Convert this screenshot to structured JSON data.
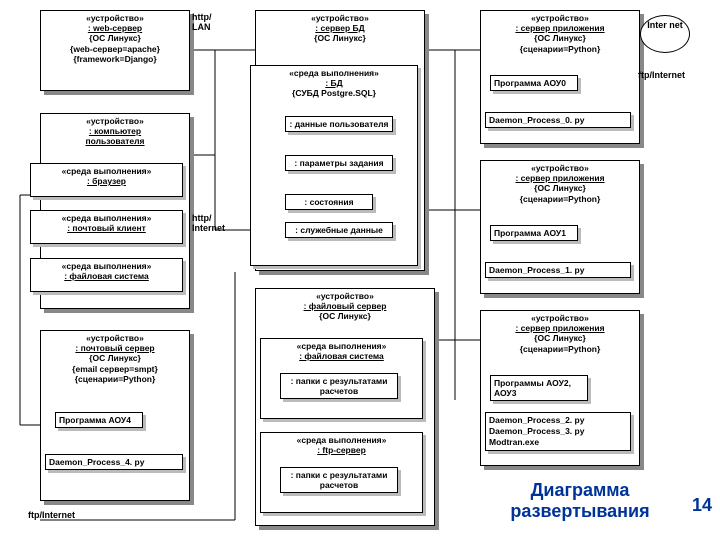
{
  "col1": {
    "web": {
      "stereo": "«устройство»",
      "name": ": web-сервер",
      "tag1": "{ОС Линукс}",
      "tag2": "{web-сервер=apache}",
      "tag3": "{framework=Django}"
    },
    "user": {
      "stereo": "«устройство»",
      "name1": ": компьютер",
      "name2": "пользователя",
      "env1": {
        "s": "«среда выполнения»",
        "n": ": браузер"
      },
      "env2": {
        "s": "«среда выполнения»",
        "n": ": почтовый клиент"
      },
      "env3": {
        "s": "«среда выполнения»",
        "n": ": файловая система"
      }
    },
    "mail": {
      "stereo": "«устройство»",
      "name": ": почтовый сервер",
      "tag1": "{ОС Линукс}",
      "tag2": "{email сервер=smpt}",
      "tag3": "{сценарии=Python}",
      "prog": "Программа АОУ4",
      "daemon": "Daemon_Process_4. py"
    }
  },
  "col2": {
    "db": {
      "stereo": "«устройство»",
      "name": ": сервер БД",
      "tag1": "{ОС Линукс}",
      "envs": "«среда выполнения»",
      "envn": ": БД",
      "envt": "{СУБД Postgre.SQL}",
      "a1": ": данные пользователя",
      "a2": ": параметры задания",
      "a3": ": состояния",
      "a4": ": служебные данные"
    },
    "file": {
      "stereo": "«устройство»",
      "name": ": файловый сервер",
      "tag1": "{ОС Линукс}",
      "env1s": "«среда выполнения»",
      "env1n": ": файловая система",
      "art1": ": папки с результатами расчетов",
      "env2s": "«среда выполнения»",
      "env2n": ": ftp-сервер",
      "art2": ": папки с результатами расчетов"
    }
  },
  "col3": {
    "app0": {
      "stereo": "«устройство»",
      "name": ": сервер приложения",
      "tag1": "{ОС Линукс}",
      "tag2": "{сценарии=Python}",
      "prog": "Программа АОУ0",
      "daemon": "Daemon_Process_0. py"
    },
    "app1": {
      "stereo": "«устройство»",
      "name": ": сервер приложения",
      "tag1": "{ОС Линукс}",
      "tag2": "{сценарии=Python}",
      "prog": "Программа АОУ1",
      "daemon": "Daemon_Process_1. py"
    },
    "app2": {
      "stereo": "«устройство»",
      "name": ": сервер приложения",
      "tag1": "{ОС Линукс}",
      "tag2": "{сценарии=Python}",
      "prog": "Программы АОУ2, АОУ3",
      "daemon1": "Daemon_Process_2. py",
      "daemon2": "Daemon_Process_3. py",
      "daemon3": "Modtran.exe"
    }
  },
  "labels": {
    "http_lan": "http/ LAN",
    "http_inet": "http/ Internet",
    "ftp_inet1": "ftp/Internet",
    "ftp_inet2": "ftp/Internet",
    "internet": "Inter net"
  },
  "title": "Диаграмма развертывания",
  "page": "14"
}
